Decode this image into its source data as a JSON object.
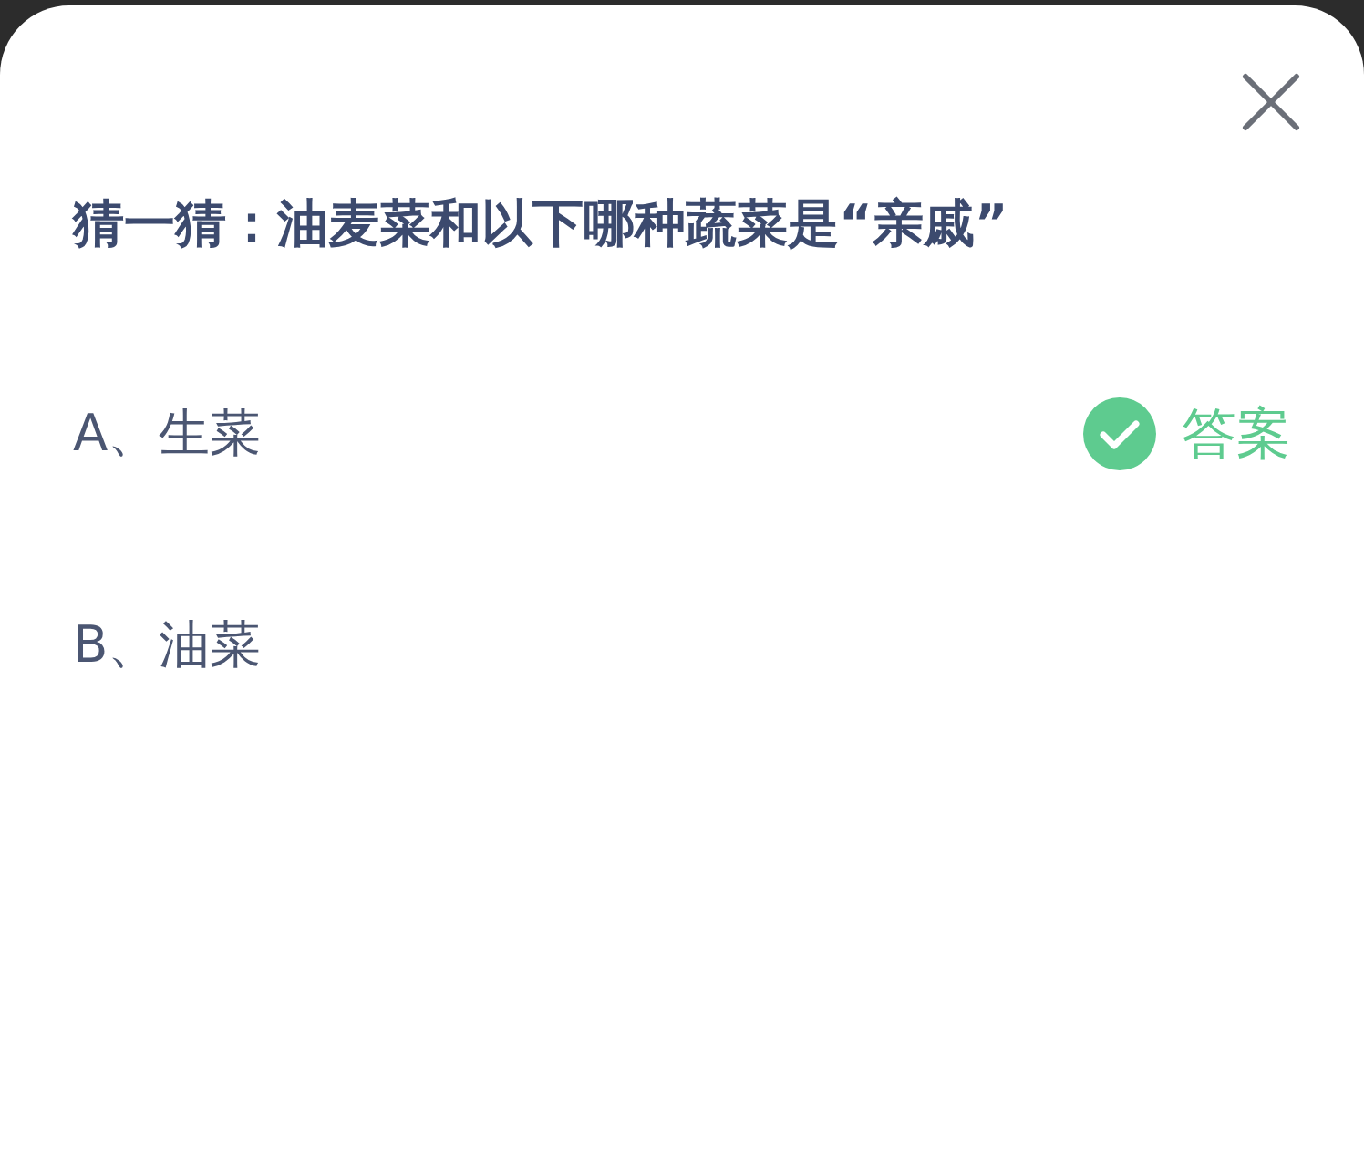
{
  "title": "猜一猜：油麦菜和以下哪种蔬菜是“亲戚”",
  "options": [
    {
      "label": "A、生菜",
      "correct": true,
      "badge": "答案"
    },
    {
      "label": "B、油菜",
      "correct": false
    }
  ]
}
